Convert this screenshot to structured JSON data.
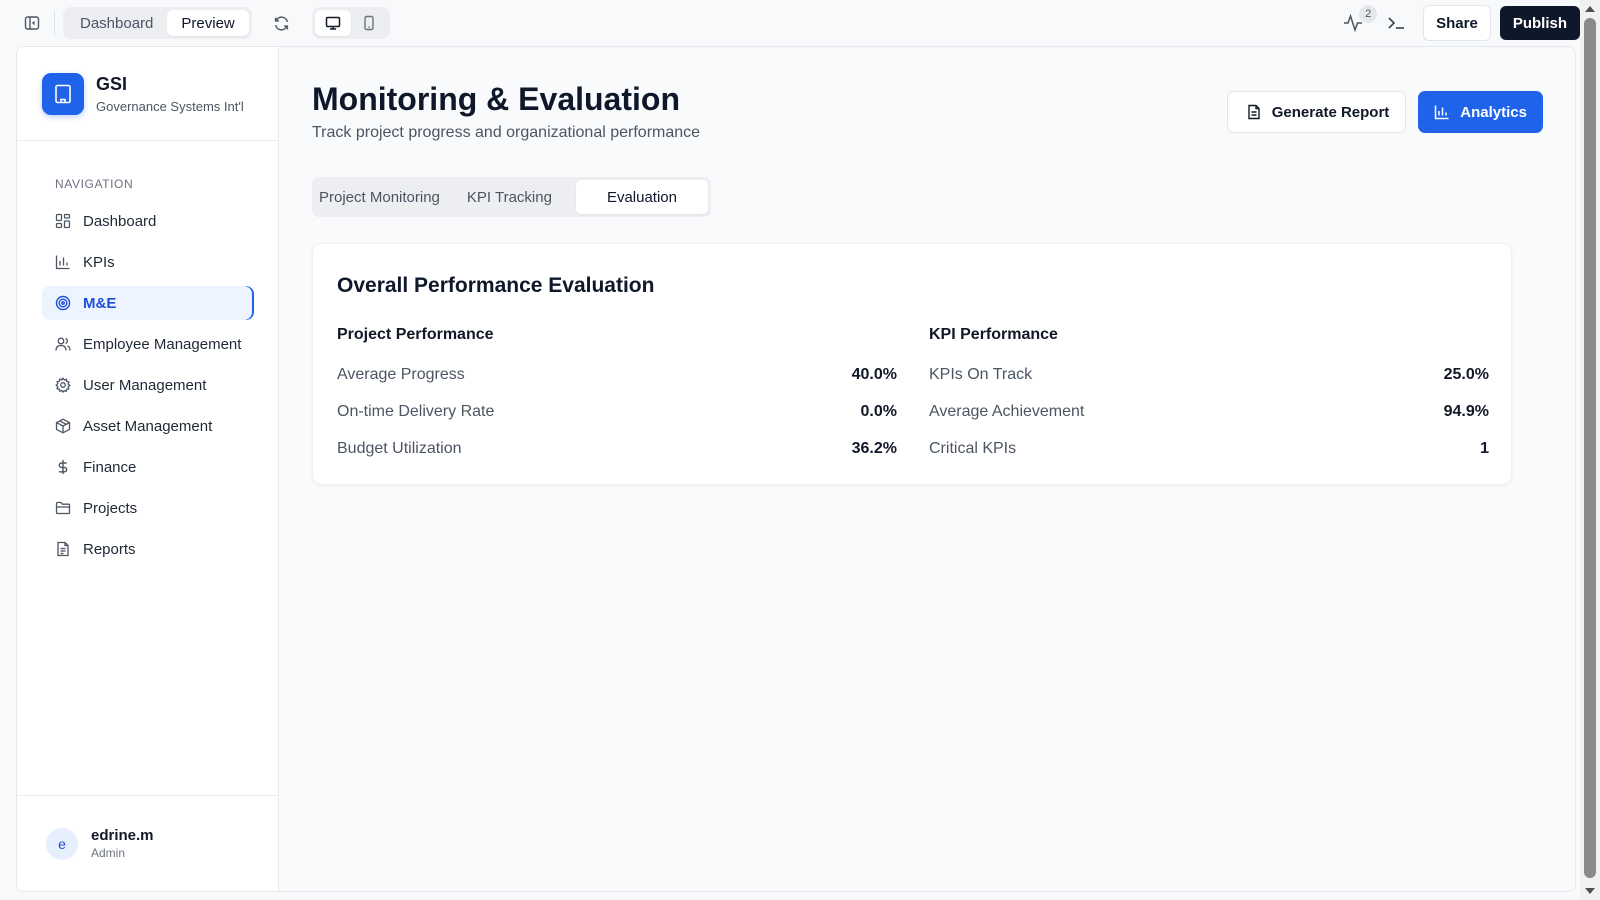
{
  "topbar": {
    "toggle_sidebar_icon": "panel-left-icon",
    "view_tabs": [
      {
        "label": "Dashboard",
        "active": false
      },
      {
        "label": "Preview",
        "active": true
      }
    ],
    "refresh_icon": "refresh-icon",
    "devices": [
      {
        "icon": "monitor-icon",
        "active": true
      },
      {
        "icon": "smartphone-icon",
        "active": false
      }
    ],
    "activity_icon": "activity-icon",
    "activity_badge": "2",
    "terminal_icon": "terminal-icon",
    "share_label": "Share",
    "publish_label": "Publish"
  },
  "brand": {
    "logo_icon": "building-icon",
    "name": "GSI",
    "subtitle": "Governance Systems Int'l",
    "color": "#1e63ea"
  },
  "sidebar": {
    "heading": "NAVIGATION",
    "items": [
      {
        "label": "Dashboard",
        "icon": "grid-icon",
        "active": false
      },
      {
        "label": "KPIs",
        "icon": "bar-chart-icon",
        "active": false
      },
      {
        "label": "M&E",
        "icon": "target-icon",
        "active": true
      },
      {
        "label": "Employee Management",
        "icon": "users-icon",
        "active": false
      },
      {
        "label": "User Management",
        "icon": "gear-icon",
        "active": false
      },
      {
        "label": "Asset Management",
        "icon": "package-icon",
        "active": false
      },
      {
        "label": "Finance",
        "icon": "dollar-icon",
        "active": false
      },
      {
        "label": "Projects",
        "icon": "folder-icon",
        "active": false
      },
      {
        "label": "Reports",
        "icon": "file-text-icon",
        "active": false
      }
    ]
  },
  "user": {
    "initial": "e",
    "name": "edrine.m",
    "role": "Admin"
  },
  "page": {
    "title": "Monitoring & Evaluation",
    "subtitle": "Track project progress and organizational performance",
    "generate_report_label": "Generate Report",
    "analytics_label": "Analytics",
    "tabs": [
      {
        "label": "Project Monitoring",
        "active": false
      },
      {
        "label": "KPI Tracking",
        "active": false
      },
      {
        "label": "Evaluation",
        "active": true
      }
    ]
  },
  "evaluation": {
    "title": "Overall Performance Evaluation",
    "project": {
      "title": "Project Performance",
      "rows": [
        {
          "label": "Average Progress",
          "value": "40.0%"
        },
        {
          "label": "On-time Delivery Rate",
          "value": "0.0%"
        },
        {
          "label": "Budget Utilization",
          "value": "36.2%"
        }
      ]
    },
    "kpi": {
      "title": "KPI Performance",
      "rows": [
        {
          "label": "KPIs On Track",
          "value": "25.0%"
        },
        {
          "label": "Average Achievement",
          "value": "94.9%"
        },
        {
          "label": "Critical KPIs",
          "value": "1"
        }
      ]
    }
  },
  "colors": {
    "accent": "#1e63ea",
    "publish": "#0f172a"
  }
}
